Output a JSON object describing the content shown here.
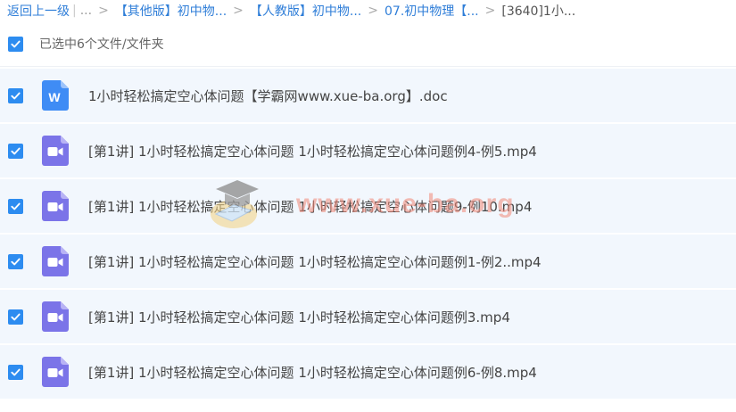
{
  "breadcrumb": {
    "back_label": "返回上一级",
    "ellipsis": "...",
    "items": [
      "【其他版】初中物...",
      "【人教版】初中物...",
      "07.初中物理【..."
    ],
    "current": "[3640]1小..."
  },
  "selection": {
    "label": "已选中6个文件/文件夹"
  },
  "files": [
    {
      "name": "1小时轻松搞定空心体问题【学霸网www.xue-ba.org】.doc",
      "type": "doc",
      "icon": "word-doc-icon",
      "icon_letter": "W"
    },
    {
      "name": "[第1讲] 1小时轻松搞定空心体问题 1小时轻松搞定空心体问题例4-例5.mp4",
      "type": "video",
      "icon": "video-file-icon"
    },
    {
      "name": "[第1讲] 1小时轻松搞定空心体问题 1小时轻松搞定空心体问题9-例10.mp4",
      "type": "video",
      "icon": "video-file-icon"
    },
    {
      "name": "[第1讲] 1小时轻松搞定空心体问题 1小时轻松搞定空心体问题例1-例2..mp4",
      "type": "video",
      "icon": "video-file-icon"
    },
    {
      "name": "[第1讲] 1小时轻松搞定空心体问题 1小时轻松搞定空心体问题例3.mp4",
      "type": "video",
      "icon": "video-file-icon"
    },
    {
      "name": "[第1讲] 1小时轻松搞定空心体问题 1小时轻松搞定空心体问题例6-例8.mp4",
      "type": "video",
      "icon": "video-file-icon"
    }
  ],
  "watermark": {
    "text": "www.xue-ba.org"
  },
  "colors": {
    "link": "#2f7ed8",
    "checkbox": "#2d8cf0",
    "row_bg": "#f2f7fd",
    "doc_icon": "#3f8cf5",
    "video_icon": "#7b74e8",
    "watermark": "#f08a7a"
  }
}
